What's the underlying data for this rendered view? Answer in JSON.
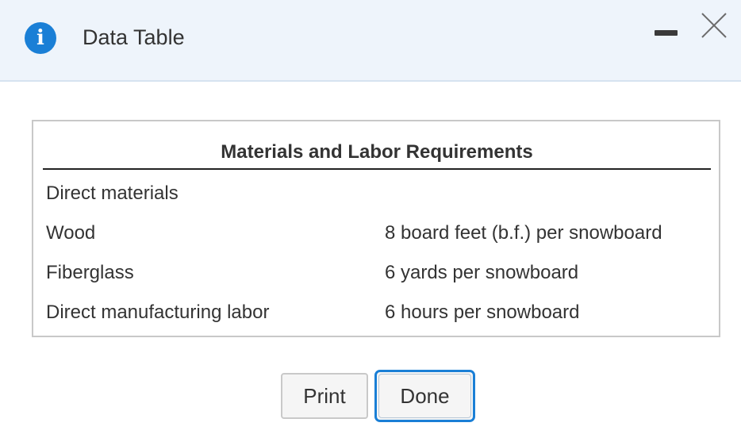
{
  "dialog": {
    "title": "Data Table",
    "info_icon_glyph": "i",
    "icons": [
      "info-icon",
      "minimize-icon",
      "close-icon"
    ],
    "colors": {
      "titlebar_bg": "#eef4fb",
      "accent": "#1a7fd6"
    }
  },
  "table": {
    "heading": "Materials and Labor Requirements",
    "rows": [
      {
        "item": "Direct materials",
        "requirement": ""
      },
      {
        "item": "Wood",
        "requirement": "8 board feet (b.f.) per snowboard"
      },
      {
        "item": "Fiberglass",
        "requirement": "6 yards per snowboard"
      },
      {
        "item": "Direct manufacturing labor",
        "requirement": "6 hours per snowboard"
      }
    ]
  },
  "buttons": {
    "print_label": "Print",
    "done_label": "Done"
  }
}
